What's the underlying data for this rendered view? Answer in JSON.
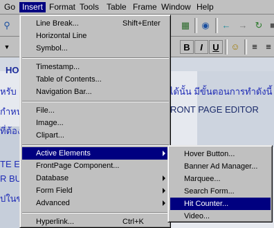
{
  "menubar": {
    "items": [
      {
        "label": "Go",
        "active": false
      },
      {
        "label": "Insert",
        "active": true
      },
      {
        "label": "Format",
        "active": false
      },
      {
        "label": "Tools",
        "active": false
      },
      {
        "label": "Table",
        "active": false
      },
      {
        "label": "Frame",
        "active": false
      },
      {
        "label": "Window",
        "active": false
      },
      {
        "label": "Help",
        "active": false
      }
    ]
  },
  "toolbar": {
    "format_buttons": [
      "B",
      "I",
      "U"
    ]
  },
  "document": {
    "lines": [
      "HO",
      "หรับ",
      "ได้นั้น มีขั้นตอนการทำดังนี้",
      "กำหน",
      "RONT PAGE EDITOR",
      "ที่ต้อง",
      "TE EL",
      "R BUT",
      "ปในข"
    ]
  },
  "insert_menu": {
    "groups": [
      [
        {
          "label": "Line Break...",
          "shortcut": "Shift+Enter"
        },
        {
          "label": "Horizontal Line"
        },
        {
          "label": "Symbol..."
        }
      ],
      [
        {
          "label": "Timestamp..."
        },
        {
          "label": "Table of Contents..."
        },
        {
          "label": "Navigation Bar..."
        }
      ],
      [
        {
          "label": "File..."
        },
        {
          "label": "Image..."
        },
        {
          "label": "Clipart..."
        }
      ],
      [
        {
          "label": "Active Elements",
          "submenu": true,
          "highlighted": true
        },
        {
          "label": "FrontPage Component..."
        },
        {
          "label": "Database",
          "submenu": true
        },
        {
          "label": "Form Field",
          "submenu": true
        },
        {
          "label": "Advanced",
          "submenu": true
        }
      ],
      [
        {
          "label": "Hyperlink...",
          "shortcut": "Ctrl+K"
        }
      ]
    ]
  },
  "active_elements_submenu": {
    "items": [
      {
        "label": "Hover Button..."
      },
      {
        "label": "Banner Ad Manager..."
      },
      {
        "label": "Marquee..."
      },
      {
        "label": "Search Form..."
      },
      {
        "label": "Hit Counter...",
        "highlighted": true
      },
      {
        "label": "Video..."
      }
    ]
  },
  "colors": {
    "highlight": "#000080",
    "menu_bg": "#c0c0c0",
    "doc_text": "#1e2bb5"
  }
}
